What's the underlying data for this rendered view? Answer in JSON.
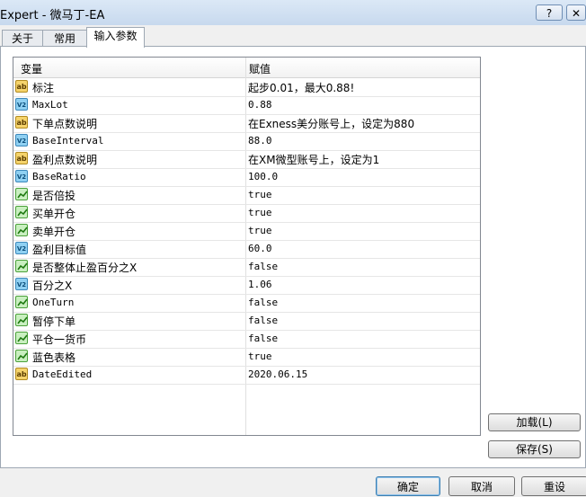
{
  "window": {
    "title": "Expert - 微马丁-EA",
    "help_label": "?",
    "close_label": "✕"
  },
  "tabs": [
    {
      "label": "关于"
    },
    {
      "label": "常用"
    },
    {
      "label": "输入参数"
    }
  ],
  "grid": {
    "headers": {
      "variable": "变量",
      "value": "赋值"
    },
    "rows": [
      {
        "icon": "ab",
        "name": "标注",
        "value": "起步0.01，最大0.88!"
      },
      {
        "icon": "v2",
        "name": "MaxLot",
        "value": "0.88"
      },
      {
        "icon": "ab",
        "name": "下单点数说明",
        "value": "在Exness美分账号上，设定为880"
      },
      {
        "icon": "v2",
        "name": "BaseInterval",
        "value": "88.0"
      },
      {
        "icon": "ab",
        "name": "盈利点数说明",
        "value": "在XM微型账号上，设定为1"
      },
      {
        "icon": "v2",
        "name": "BaseRatio",
        "value": "100.0"
      },
      {
        "icon": "bool",
        "name": "是否倍投",
        "value": "true"
      },
      {
        "icon": "bool",
        "name": "买单开仓",
        "value": "true"
      },
      {
        "icon": "bool",
        "name": "卖单开仓",
        "value": "true"
      },
      {
        "icon": "v2",
        "name": "盈利目标值",
        "value": "60.0"
      },
      {
        "icon": "bool",
        "name": "是否整体止盈百分之X",
        "value": "false"
      },
      {
        "icon": "v2",
        "name": "百分之X",
        "value": "1.06"
      },
      {
        "icon": "bool",
        "name": "OneTurn",
        "value": "false"
      },
      {
        "icon": "bool",
        "name": "暂停下单",
        "value": "false"
      },
      {
        "icon": "bool",
        "name": "平仓一货币",
        "value": "false"
      },
      {
        "icon": "bool",
        "name": "蓝色表格",
        "value": "true"
      },
      {
        "icon": "ab",
        "name": "DateEdited",
        "value": "2020.06.15"
      }
    ]
  },
  "side_buttons": {
    "load": "加载(L)",
    "save": "保存(S)"
  },
  "bottom_buttons": {
    "ok": "确定",
    "cancel": "取消",
    "reset": "重设"
  },
  "icon_text": {
    "ab": "ab",
    "v2": "V2"
  }
}
